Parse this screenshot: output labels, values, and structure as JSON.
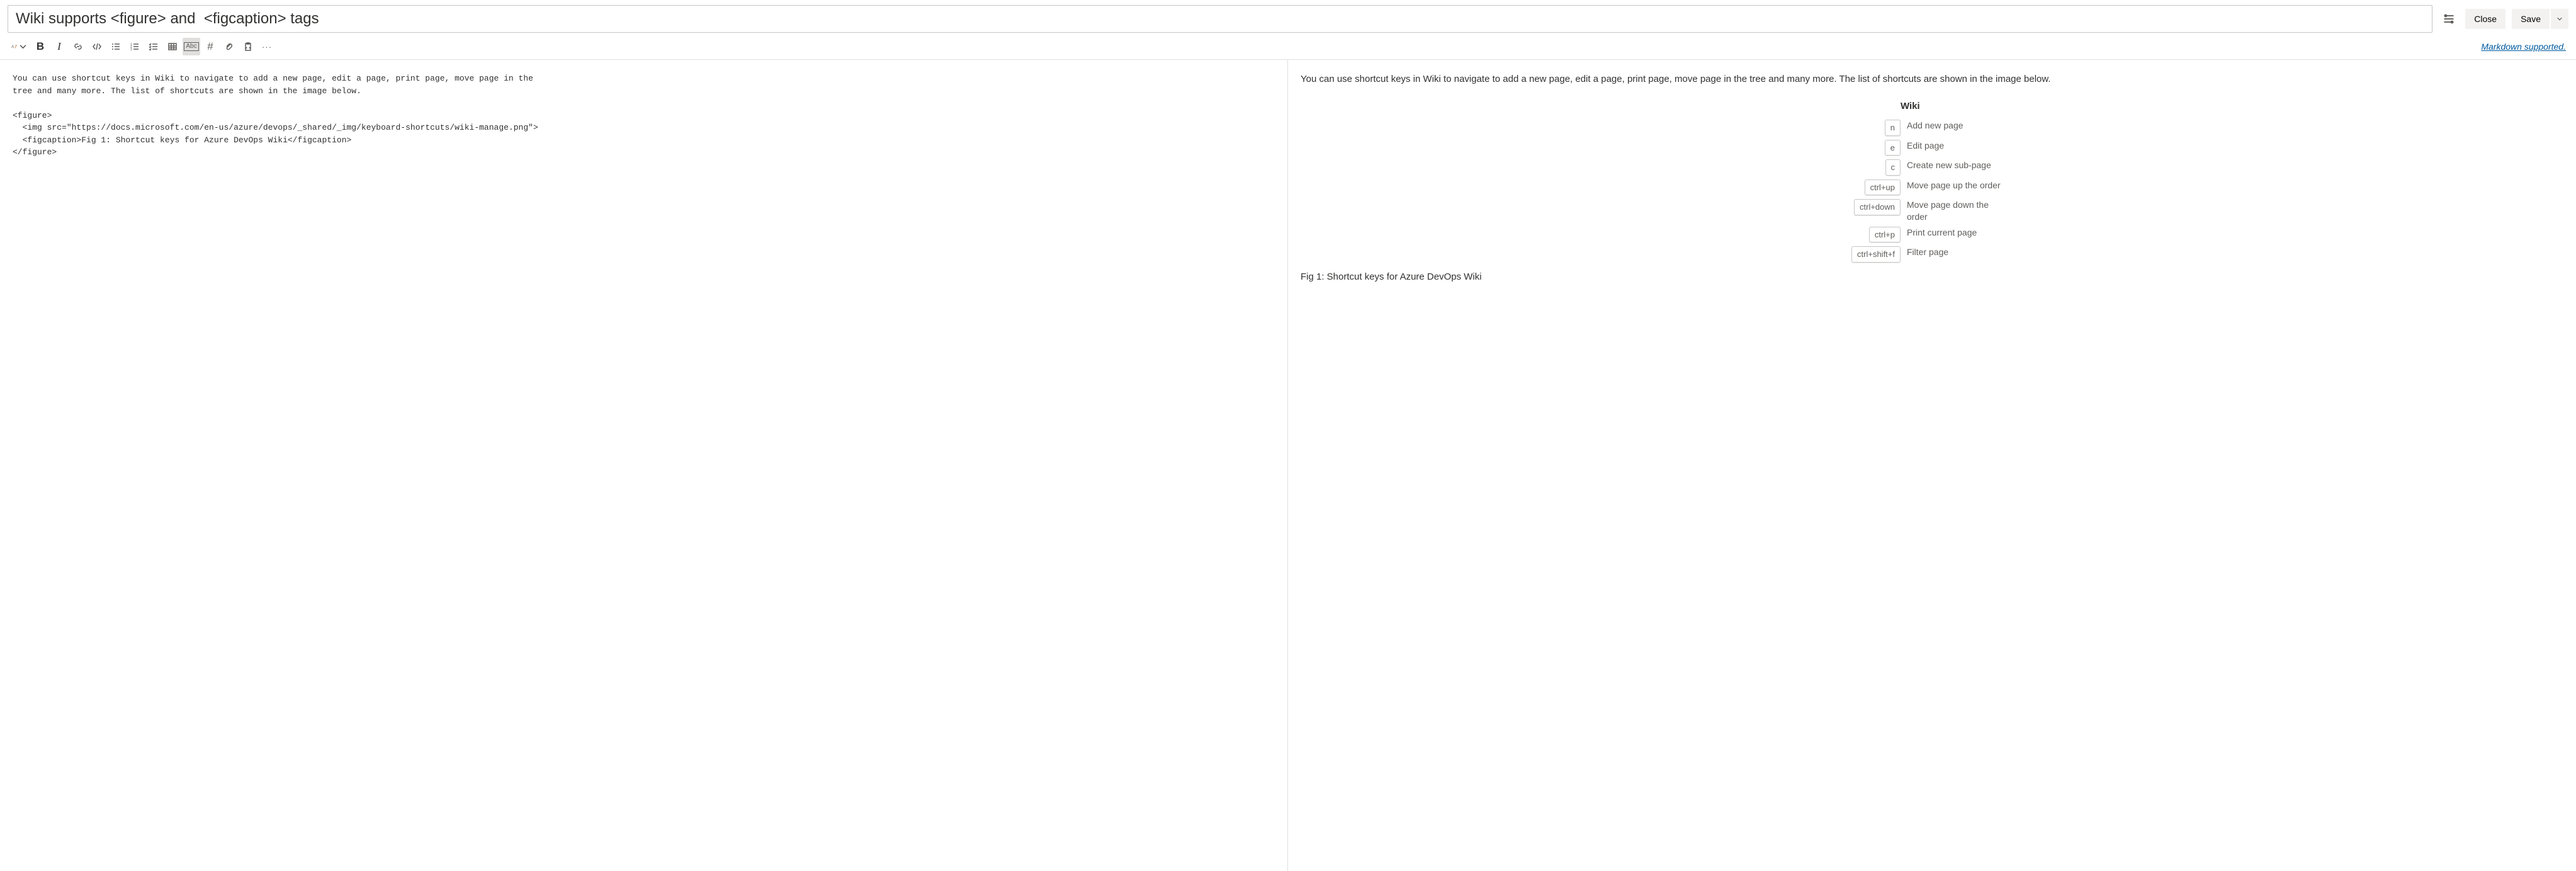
{
  "header": {
    "title": "Wiki supports <figure> and  <figcaption> tags",
    "close": "Close",
    "save": "Save"
  },
  "toolbar": {
    "markdown_link": "Markdown supported.",
    "items": [
      {
        "name": "Header size"
      },
      {
        "name": "Bold"
      },
      {
        "name": "Italic"
      },
      {
        "name": "Link"
      },
      {
        "name": "Code"
      },
      {
        "name": "Bulleted list"
      },
      {
        "name": "Numbered list"
      },
      {
        "name": "Task list"
      },
      {
        "name": "Table"
      },
      {
        "name": "Insert label",
        "active": true
      },
      {
        "name": "Hash / Mention"
      },
      {
        "name": "Attach file"
      },
      {
        "name": "Paste as HTML"
      },
      {
        "name": "More options"
      }
    ]
  },
  "editor_content": "You can use shortcut keys in Wiki to navigate to add a new page, edit a page, print page, move page in the\ntree and many more. The list of shortcuts are shown in the image below.\n\n<figure>\n  <img src=\"https://docs.microsoft.com/en-us/azure/devops/_shared/_img/keyboard-shortcuts/wiki-manage.png\">\n  <figcaption>Fig 1: Shortcut keys for Azure DevOps Wiki</figcaption>\n</figure>",
  "preview": {
    "intro": "You can use shortcut keys in Wiki to navigate to add a new page, edit a page, print page, move page in the tree and many more. The list of shortcuts are shown in the image below.",
    "kb_title": "Wiki",
    "shortcuts": [
      {
        "key": "n",
        "label": "Add new page"
      },
      {
        "key": "e",
        "label": "Edit page"
      },
      {
        "key": "c",
        "label": "Create new sub-page"
      },
      {
        "key": "ctrl+up",
        "label": "Move page up the order"
      },
      {
        "key": "ctrl+down",
        "label": "Move page down the order"
      },
      {
        "key": "ctrl+p",
        "label": "Print current page"
      },
      {
        "key": "ctrl+shift+f",
        "label": "Filter page"
      }
    ],
    "figcaption": "Fig 1: Shortcut keys for Azure DevOps Wiki"
  }
}
